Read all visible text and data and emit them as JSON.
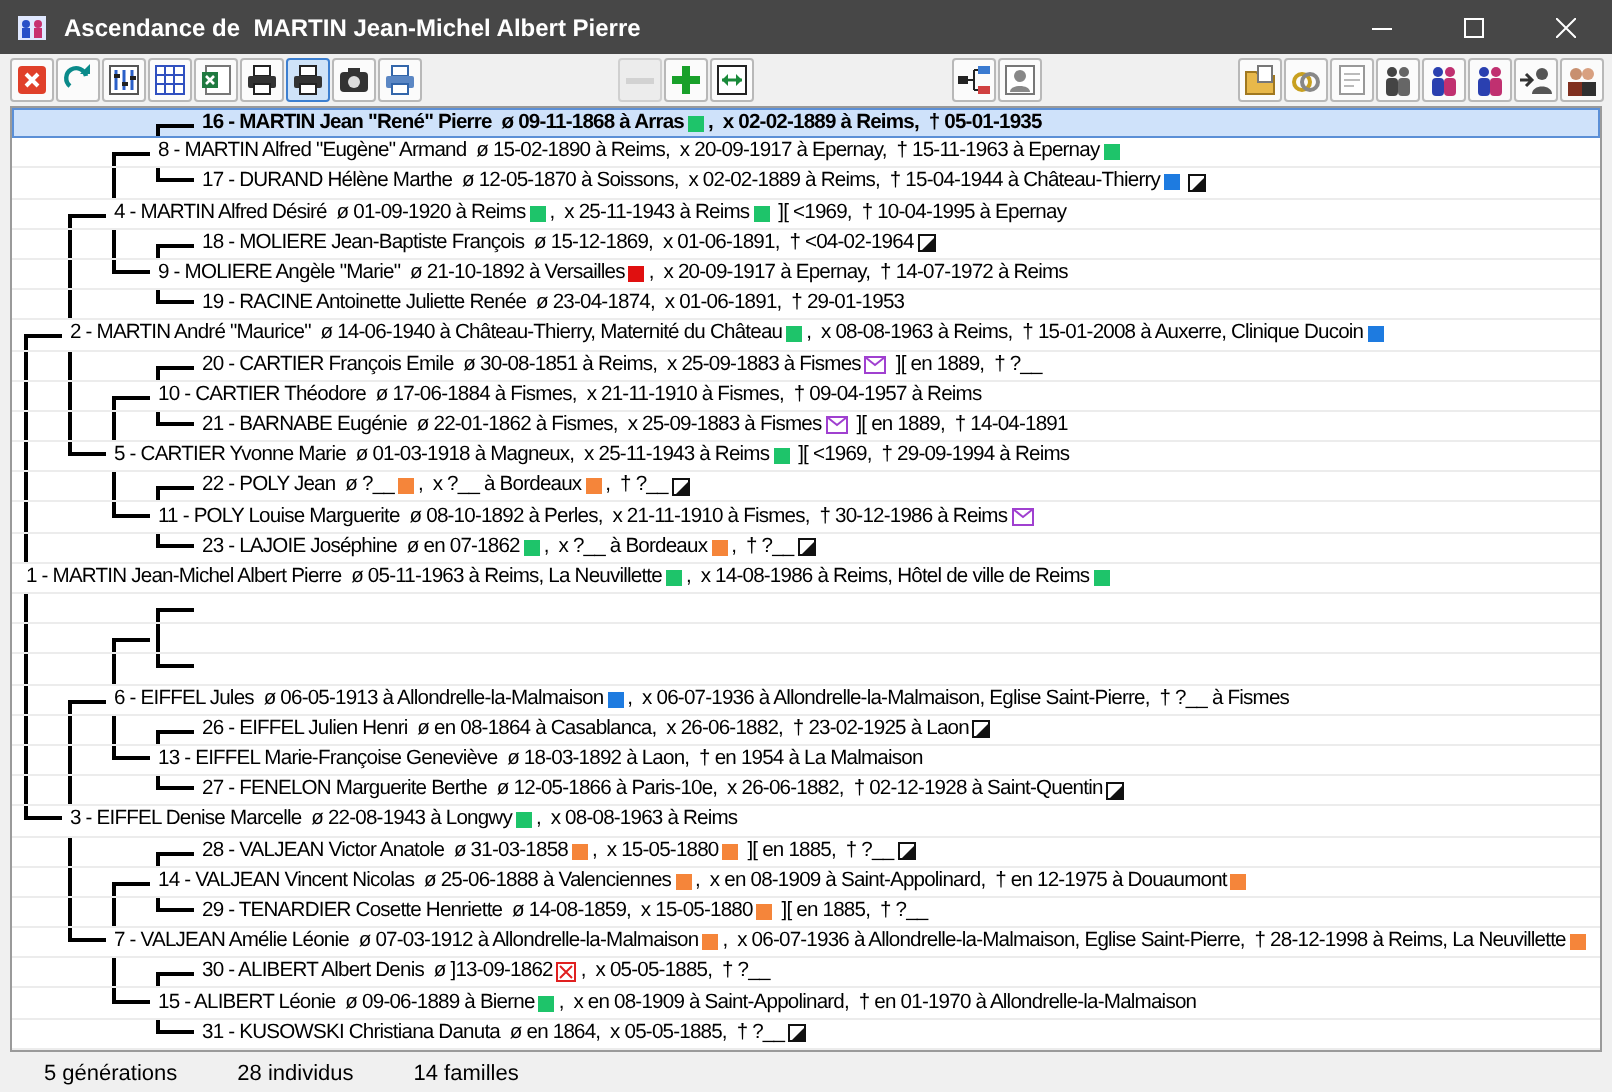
{
  "window": {
    "title": "Ascendance de  MARTIN Jean-Michel Albert Pierre"
  },
  "toolbar": {
    "groups": [
      [
        {
          "kind": "close",
          "pressed": false,
          "disabled": false
        },
        {
          "kind": "refresh",
          "pressed": false,
          "disabled": false
        },
        {
          "kind": "sliders",
          "pressed": false,
          "disabled": false
        },
        {
          "kind": "grid",
          "pressed": false,
          "disabled": false
        },
        {
          "kind": "sheet",
          "pressed": false,
          "disabled": false
        },
        {
          "kind": "printer",
          "pressed": false,
          "disabled": false
        },
        {
          "kind": "printer",
          "pressed": true,
          "disabled": false
        },
        {
          "kind": "camera",
          "pressed": false,
          "disabled": false
        },
        {
          "kind": "colorprinter",
          "pressed": false,
          "disabled": false
        }
      ],
      [
        {
          "kind": "minus",
          "pressed": false,
          "disabled": true
        },
        {
          "kind": "plus",
          "pressed": false,
          "disabled": false
        },
        {
          "kind": "expand",
          "pressed": false,
          "disabled": false
        }
      ],
      [
        {
          "kind": "tree",
          "pressed": false,
          "disabled": false
        },
        {
          "kind": "person",
          "pressed": false,
          "disabled": false
        }
      ],
      [
        {
          "kind": "folder",
          "pressed": false,
          "disabled": false
        },
        {
          "kind": "rings",
          "pressed": false,
          "disabled": false
        },
        {
          "kind": "document",
          "pressed": false,
          "disabled": false
        },
        {
          "kind": "people",
          "pressed": false,
          "disabled": false
        },
        {
          "kind": "peopleblue",
          "pressed": false,
          "disabled": false
        },
        {
          "kind": "peopleblue",
          "pressed": false,
          "disabled": false
        },
        {
          "kind": "personarrow",
          "pressed": false,
          "disabled": false
        },
        {
          "kind": "couple",
          "pressed": false,
          "disabled": false
        }
      ]
    ]
  },
  "tree": {
    "root": {
      "selected": false,
      "parts": [
        {
          "kind": "text",
          "text": "1 - MARTIN Jean-Michel Albert Pierre  ø 05-11-1963 à Reims, La Neuvillette"
        },
        {
          "kind": "square",
          "color": "#1ec46a"
        },
        {
          "kind": "text",
          "text": ",  x 14-08-1986 à Reims, Hôtel de ville de Reims"
        },
        {
          "kind": "square",
          "color": "#1ec46a"
        }
      ],
      "children": [
        {
          "selected": false,
          "parts": [
            {
              "kind": "text",
              "text": "2 - MARTIN André \"Maurice\"  ø 14-06-1940 à Château-Thierry, Maternité du Château"
            },
            {
              "kind": "square",
              "color": "#1ec46a"
            },
            {
              "kind": "text",
              "text": ",  x 08-08-1963 à Reims,  † 15-01-2008 à Auxerre, Clinique Ducoin"
            },
            {
              "kind": "square",
              "color": "#1e7be0"
            }
          ],
          "children": [
            {
              "selected": false,
              "parts": [
                {
                  "kind": "text",
                  "text": "4 - MARTIN Alfred Désiré  ø 01-09-1920 à Reims"
                },
                {
                  "kind": "square",
                  "color": "#1ec46a"
                },
                {
                  "kind": "text",
                  "text": ",  x 25-11-1943 à Reims"
                },
                {
                  "kind": "square",
                  "color": "#1ec46a"
                },
                {
                  "kind": "text",
                  "text": " ][ <1969,  † 10-04-1995 à Epernay"
                }
              ],
              "children": [
                {
                  "selected": false,
                  "parts": [
                    {
                      "kind": "text",
                      "text": "8 - MARTIN Alfred \"Eugène\" Armand  ø 15-02-1890 à Reims,  x 20-09-1917 à Epernay,  † 15-11-1963 à Epernay"
                    },
                    {
                      "kind": "square",
                      "color": "#1ec46a"
                    }
                  ],
                  "children": [
                    {
                      "selected": true,
                      "parts": [
                        {
                          "kind": "text",
                          "text": "16 - MARTIN Jean \"René\" Pierre  ø 09-11-1868 à Arras"
                        },
                        {
                          "kind": "square",
                          "color": "#1ec46a"
                        },
                        {
                          "kind": "text",
                          "text": ",  x 02-02-1889 à Reims,  † 05-01-1935"
                        }
                      ]
                    },
                    {
                      "selected": false,
                      "parts": [
                        {
                          "kind": "text",
                          "text": "17 - DURAND Hélène Marthe  ø 12-05-1870 à Soissons,  x 02-02-1889 à Reims,  † 15-04-1944 à Château-Thierry"
                        },
                        {
                          "kind": "square",
                          "color": "#1e7be0"
                        },
                        {
                          "kind": "note"
                        }
                      ]
                    }
                  ]
                },
                {
                  "selected": false,
                  "parts": [
                    {
                      "kind": "text",
                      "text": "9 - MOLIERE Angèle \"Marie\"  ø 21-10-1892 à Versailles"
                    },
                    {
                      "kind": "square",
                      "color": "#e01010"
                    },
                    {
                      "kind": "text",
                      "text": ",  x 20-09-1917 à Epernay,  † 14-07-1972 à Reims"
                    }
                  ],
                  "children": [
                    {
                      "selected": false,
                      "parts": [
                        {
                          "kind": "text",
                          "text": "18 - MOLIERE Jean-Baptiste François  ø 15-12-1869,  x 01-06-1891,  † <04-02-1964"
                        },
                        {
                          "kind": "note"
                        }
                      ]
                    },
                    {
                      "selected": false,
                      "parts": [
                        {
                          "kind": "text",
                          "text": "19 - RACINE Antoinette Juliette Renée  ø 23-04-1874,  x 01-06-1891,  † 29-01-1953"
                        }
                      ]
                    }
                  ]
                }
              ]
            },
            {
              "selected": false,
              "parts": [
                {
                  "kind": "text",
                  "text": "5 - CARTIER Yvonne Marie  ø 01-03-1918 à Magneux,  x 25-11-1943 à Reims"
                },
                {
                  "kind": "square",
                  "color": "#1ec46a"
                },
                {
                  "kind": "text",
                  "text": " ][ <1969,  † 29-09-1994 à Reims"
                }
              ],
              "children": [
                {
                  "selected": false,
                  "parts": [
                    {
                      "kind": "text",
                      "text": "10 - CARTIER Théodore  ø 17-06-1884 à Fismes,  x 21-11-1910 à Fismes,  † 09-04-1957 à Reims"
                    }
                  ],
                  "children": [
                    {
                      "selected": false,
                      "parts": [
                        {
                          "kind": "text",
                          "text": "20 - CARTIER François Emile  ø 30-08-1851 à Reims,  x 25-09-1883 à Fismes"
                        },
                        {
                          "kind": "envelope"
                        },
                        {
                          "kind": "text",
                          "text": " ][ en 1889,  † ?__"
                        }
                      ]
                    },
                    {
                      "selected": false,
                      "parts": [
                        {
                          "kind": "text",
                          "text": "21 - BARNABE Eugénie  ø 22-01-1862 à Fismes,  x 25-09-1883 à Fismes"
                        },
                        {
                          "kind": "envelope"
                        },
                        {
                          "kind": "text",
                          "text": " ][ en 1889,  † 14-04-1891"
                        }
                      ]
                    }
                  ]
                },
                {
                  "selected": false,
                  "parts": [
                    {
                      "kind": "text",
                      "text": "11 - POLY Louise Marguerite  ø 08-10-1892 à Perles,  x 21-11-1910 à Fismes,  † 30-12-1986 à Reims"
                    },
                    {
                      "kind": "envelope"
                    }
                  ],
                  "children": [
                    {
                      "selected": false,
                      "parts": [
                        {
                          "kind": "text",
                          "text": "22 - POLY Jean  ø ?__"
                        },
                        {
                          "kind": "square",
                          "color": "#f5853a"
                        },
                        {
                          "kind": "text",
                          "text": ",  x ?__ à Bordeaux"
                        },
                        {
                          "kind": "square",
                          "color": "#f5853a"
                        },
                        {
                          "kind": "text",
                          "text": ",  † ?__"
                        },
                        {
                          "kind": "note"
                        }
                      ]
                    },
                    {
                      "selected": false,
                      "parts": [
                        {
                          "kind": "text",
                          "text": "23 - LAJOIE Joséphine  ø en 07-1862"
                        },
                        {
                          "kind": "square",
                          "color": "#1ec46a"
                        },
                        {
                          "kind": "text",
                          "text": ",  x ?__ à Bordeaux"
                        },
                        {
                          "kind": "square",
                          "color": "#f5853a"
                        },
                        {
                          "kind": "text",
                          "text": ",  † ?__"
                        },
                        {
                          "kind": "note"
                        }
                      ]
                    }
                  ]
                }
              ]
            }
          ]
        },
        {
          "selected": false,
          "parts": [
            {
              "kind": "text",
              "text": "3 - EIFFEL Denise Marcelle  ø 22-08-1943 à Longwy"
            },
            {
              "kind": "square",
              "color": "#1ec46a"
            },
            {
              "kind": "text",
              "text": ",  x 08-08-1963 à Reims"
            }
          ],
          "children": [
            {
              "selected": false,
              "parts": [
                {
                  "kind": "text",
                  "text": "6 - EIFFEL Jules  ø 06-05-1913 à Allondrelle-la-Malmaison"
                },
                {
                  "kind": "square",
                  "color": "#1e7be0"
                },
                {
                  "kind": "text",
                  "text": ",  x 06-07-1936 à Allondrelle-la-Malmaison, Eglise Saint-Pierre,  † ?__ à Fismes"
                }
              ],
              "children": [
                {
                  "selected": false,
                  "children": [
                    {
                      "selected": false
                    },
                    {
                      "selected": false
                    }
                  ]
                },
                {
                  "selected": false,
                  "parts": [
                    {
                      "kind": "text",
                      "text": "13 - EIFFEL Marie-Françoise Geneviève  ø 18-03-1892 à Laon,  † en 1954 à La Malmaison"
                    }
                  ],
                  "children": [
                    {
                      "selected": false,
                      "parts": [
                        {
                          "kind": "text",
                          "text": "26 - EIFFEL Julien Henri  ø en 08-1864 à Casablanca,  x 26-06-1882,  † 23-02-1925 à Laon"
                        },
                        {
                          "kind": "note"
                        }
                      ]
                    },
                    {
                      "selected": false,
                      "parts": [
                        {
                          "kind": "text",
                          "text": "27 - FENELON Marguerite Berthe  ø 12-05-1866 à Paris-10e,  x 26-06-1882,  † 02-12-1928 à Saint-Quentin"
                        },
                        {
                          "kind": "note"
                        }
                      ]
                    }
                  ]
                }
              ]
            },
            {
              "selected": false,
              "parts": [
                {
                  "kind": "text",
                  "text": "7 - VALJEAN Amélie Léonie  ø 07-03-1912 à Allondrelle-la-Malmaison"
                },
                {
                  "kind": "square",
                  "color": "#f5853a"
                },
                {
                  "kind": "text",
                  "text": ",  x 06-07-1936 à Allondrelle-la-Malmaison, Eglise Saint-Pierre,  † 28-12-1998 à Reims, La Neuvillette"
                },
                {
                  "kind": "square",
                  "color": "#f5853a"
                }
              ],
              "children": [
                {
                  "selected": false,
                  "parts": [
                    {
                      "kind": "text",
                      "text": "14 - VALJEAN Vincent Nicolas  ø 25-06-1888 à Valenciennes"
                    },
                    {
                      "kind": "square",
                      "color": "#f5853a"
                    },
                    {
                      "kind": "text",
                      "text": ",  x en 08-1909 à Saint-Appolinard,  † en 12-1975 à Douaumont"
                    },
                    {
                      "kind": "square",
                      "color": "#f5853a"
                    }
                  ],
                  "children": [
                    {
                      "selected": false,
                      "parts": [
                        {
                          "kind": "text",
                          "text": "28 - VALJEAN Victor Anatole  ø 31-03-1858"
                        },
                        {
                          "kind": "square",
                          "color": "#f5853a"
                        },
                        {
                          "kind": "text",
                          "text": ",  x 15-05-1880"
                        },
                        {
                          "kind": "square",
                          "color": "#f5853a"
                        },
                        {
                          "kind": "text",
                          "text": " ][ en 1885,  † ?__"
                        },
                        {
                          "kind": "note"
                        }
                      ]
                    },
                    {
                      "selected": false,
                      "parts": [
                        {
                          "kind": "text",
                          "text": "29 - TENARDIER Cosette Henriette  ø 14-08-1859,  x 15-05-1880"
                        },
                        {
                          "kind": "square",
                          "color": "#f5853a"
                        },
                        {
                          "kind": "text",
                          "text": " ][ en 1885,  † ?__"
                        }
                      ]
                    }
                  ]
                },
                {
                  "selected": false,
                  "parts": [
                    {
                      "kind": "text",
                      "text": "15 - ALIBERT Léonie  ø 09-06-1889 à Bierne"
                    },
                    {
                      "kind": "square",
                      "color": "#1ec46a"
                    },
                    {
                      "kind": "text",
                      "text": ",  x en 08-1909 à Saint-Appolinard,  † en 01-1970 à Allondrelle-la-Malmaison"
                    }
                  ],
                  "children": [
                    {
                      "selected": false,
                      "parts": [
                        {
                          "kind": "text",
                          "text": "30 - ALIBERT Albert Denis  ø ]13-09-1862"
                        },
                        {
                          "kind": "crossed"
                        },
                        {
                          "kind": "text",
                          "text": ",  x 05-05-1885,  † ?__"
                        }
                      ]
                    },
                    {
                      "selected": false,
                      "parts": [
                        {
                          "kind": "text",
                          "text": "31 - KUSOWSKI Christiana Danuta  ø en 1864,  x 05-05-1885,  † ?__"
                        },
                        {
                          "kind": "note"
                        }
                      ]
                    }
                  ]
                }
              ]
            }
          ]
        }
      ]
    }
  },
  "status_bar": [
    "5 générations",
    "28 individus",
    "14 familles"
  ]
}
